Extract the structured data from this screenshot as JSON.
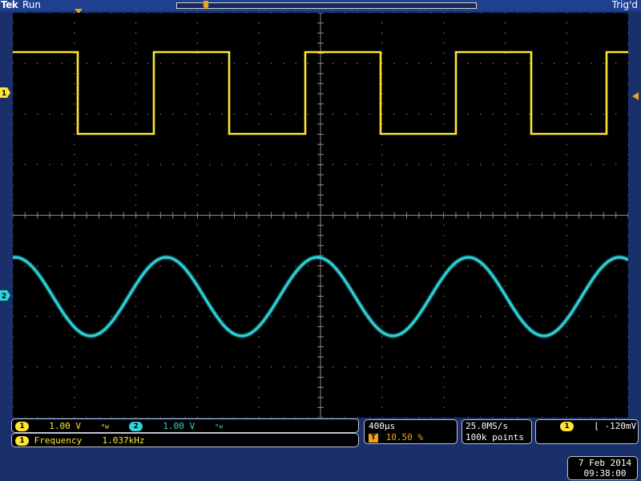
{
  "topbar": {
    "brand": "Tek",
    "run_state": "Run",
    "trigger_state": "Trig'd"
  },
  "channels": [
    {
      "id": "1",
      "color": "#ffe531",
      "scale": "1.00 V",
      "coupling_icon": "bandwidth-limit-icon"
    },
    {
      "id": "2",
      "color": "#2fd3d9",
      "scale": "1.00 V",
      "coupling_icon": "bandwidth-limit-icon"
    }
  ],
  "measurement": {
    "source": "1",
    "label": "Frequency",
    "value": "1.037kHz"
  },
  "horizontal": {
    "time_per_div": "400µs",
    "trigger_position_icon": "T",
    "trigger_position": "10.50 %"
  },
  "acquisition": {
    "sample_rate": "25.0MS/s",
    "record_length": "100k points"
  },
  "trigger": {
    "source": "1",
    "slope_icon": "falling-edge-icon",
    "level": "-120mV"
  },
  "datetime": {
    "date": "7 Feb  2014",
    "time": "09:38:00"
  },
  "colors": {
    "ch1": "#ffe531",
    "ch2": "#2fd3d9",
    "trigger_orange": "#f0a21e",
    "frame": "#19306a"
  }
}
